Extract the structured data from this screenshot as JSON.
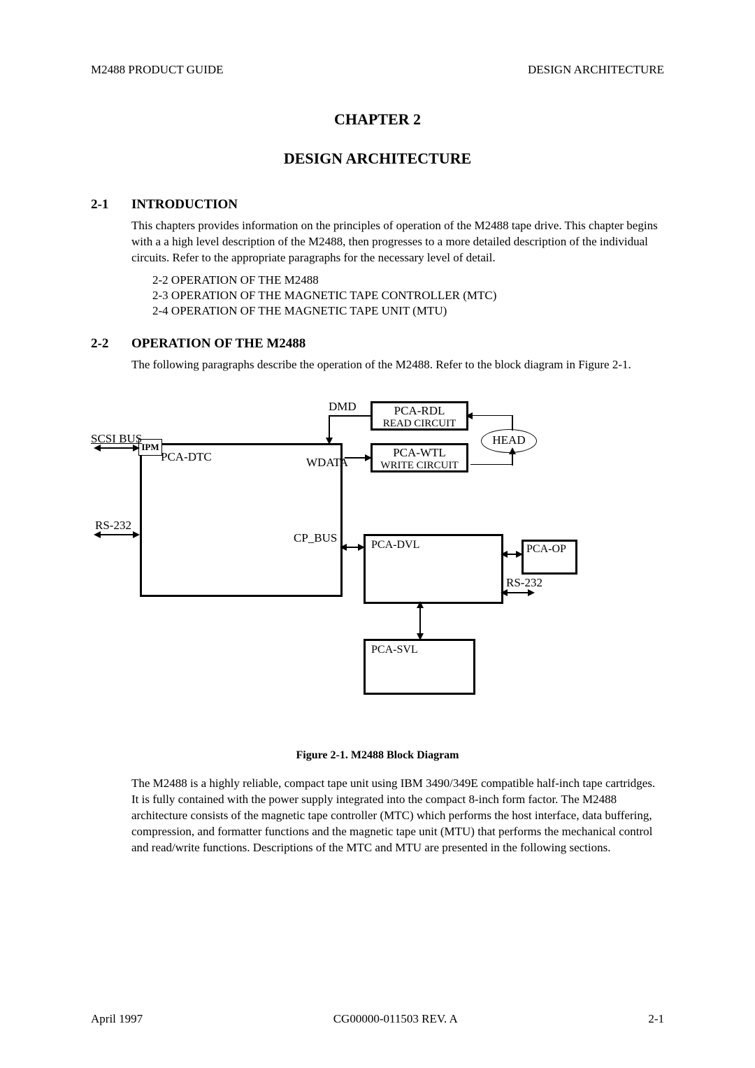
{
  "header": {
    "left": "M2488 PRODUCT GUIDE",
    "right": "DESIGN ARCHITECTURE"
  },
  "chapter": "CHAPTER 2",
  "title": "DESIGN ARCHITECTURE",
  "sections": {
    "s1": {
      "num": "2-1",
      "title": "INTRODUCTION",
      "body": "This chapters provides information on the principles of operation of the M2488 tape drive. This chapter begins with a a high level description of the M2488, then progresses to a more detailed description of the individual circuits. Refer to the appropriate paragraphs for the necessary level of detail.",
      "toc": [
        "2-2  OPERATION OF THE M2488",
        "2-3  OPERATION OF THE MAGNETIC TAPE CONTROLLER (MTC)",
        "2-4  OPERATION OF THE MAGNETIC TAPE UNIT (MTU)"
      ]
    },
    "s2": {
      "num": "2-2",
      "title": "OPERATION OF THE M2488",
      "body": "The following paragraphs describe the operation of the M2488. Refer to the block diagram in Figure 2-1."
    }
  },
  "diagram": {
    "labels": {
      "scsi_bus": "SCSI BUS",
      "ipm": "IPM",
      "pca_dtc": "PCA-DTC",
      "rs232_left": "RS-232",
      "dmd": "DMD",
      "wdata": "WDATA",
      "cp_bus": "CP_BUS",
      "pca_rdl": "PCA-RDL",
      "read_circuit": "READ CIRCUIT",
      "pca_wtl": "PCA-WTL",
      "write_circuit": "WRITE CIRCUIT",
      "head": "HEAD",
      "pca_dvl": "PCA-DVL",
      "pca_op": "PCA-OP",
      "rs232_right": "RS-232",
      "pca_svl": "PCA-SVL"
    }
  },
  "figure_caption": "Figure 2-1.  M2488 Block Diagram",
  "body_after_figure": "The M2488 is a highly reliable, compact tape unit using IBM 3490/349E compatible half-inch tape cartridges. It is fully contained with the power supply integrated into the compact 8-inch form factor. The M2488 architecture consists of the magnetic tape controller (MTC) which performs the host interface, data buffering, compression, and formatter functions and the magnetic tape unit (MTU) that performs the mechanical control and read/write functions. Descriptions of the MTC and MTU are presented in the following sections.",
  "footer": {
    "left": "April 1997",
    "center": "CG00000-011503 REV. A",
    "right": "2-1"
  }
}
